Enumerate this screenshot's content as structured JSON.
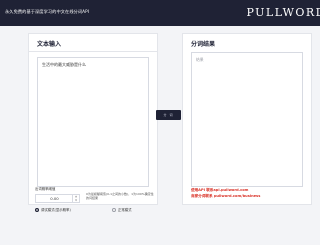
{
  "header": {
    "tagline": "永久免费的基于深度学习的中文在线分词API",
    "brand": "PULLWORD"
  },
  "input_panel": {
    "title": "文本输入",
    "text_value": "生活中的最大威胁是什么"
  },
  "action": {
    "segment_label": "分 词"
  },
  "result_panel": {
    "title": "分词结果",
    "result_placeholder": "结果",
    "contact_line1": "使用API 联系api.pullword.com",
    "contact_line2": "商家分词联系 pullword.com/business"
  },
  "options": {
    "threshold_label": "出词概率阈值",
    "threshold_value": "0.00",
    "threshold_note": "0为最模糊阈值(0-1之间的小数)，1为100%确定性的词结果",
    "radio_debug_label": "调试模式(显示概率)",
    "radio_normal_label": "正常模式",
    "selected_mode": "debug"
  }
}
